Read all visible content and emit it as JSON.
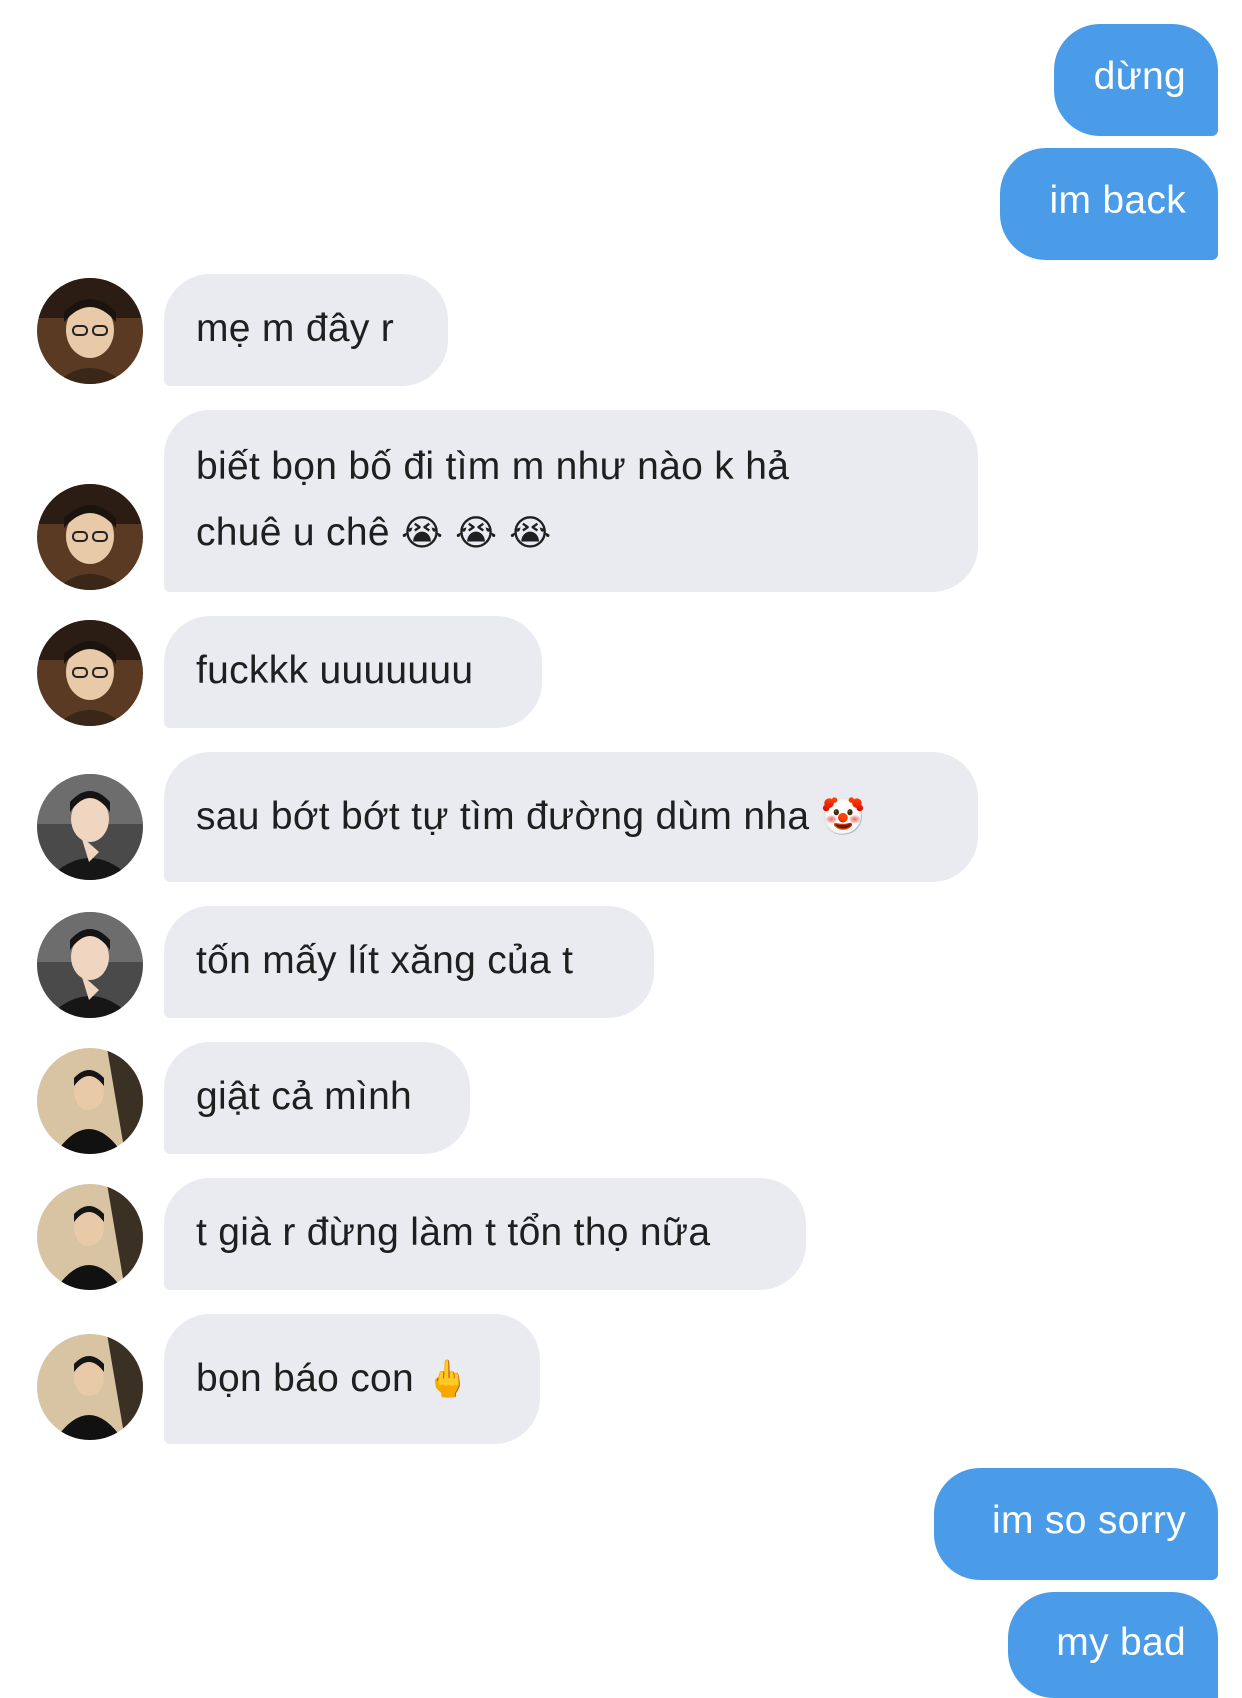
{
  "messages": {
    "m1": "dừng",
    "m2": "im back",
    "m3": "mẹ m đây r",
    "m4_line1": "biết bọn bố đi tìm m như nào k hả",
    "m4_line2": "chuê u chê",
    "m4_emoji": "😭 😭 😭",
    "m5": "fuckkk uuuuuuu",
    "m6": "sau bớt bớt tự tìm đường dùm nha",
    "m6_emoji": "🤡",
    "m7": "tốn mấy lít xăng của t",
    "m8": "giật cả mình",
    "m9": "t già r đừng làm t tổn thọ nữa",
    "m10": "bọn báo con",
    "m10_emoji": "🖕",
    "m11": "im so sorry",
    "m12": "my bad"
  },
  "colors": {
    "outgoing_bubble": "#4b9ce8",
    "incoming_bubble": "#e9ebf0",
    "incoming_text": "#1f1f1f",
    "outgoing_text": "#ffffff"
  },
  "avatars": [
    "avatar-user-a",
    "avatar-user-b",
    "avatar-user-c"
  ]
}
